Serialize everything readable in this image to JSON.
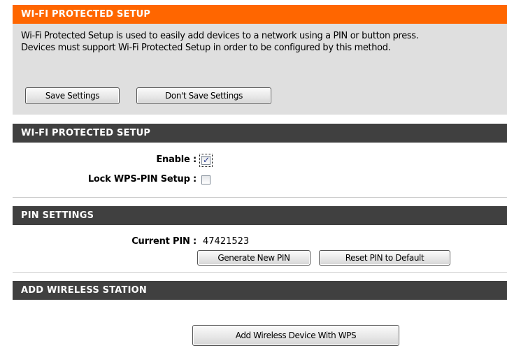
{
  "intro": {
    "header": "WI-FI PROTECTED SETUP",
    "line1": "Wi-Fi Protected Setup is used to easily add devices to a network using a PIN or button press.",
    "line2": "Devices must support Wi-Fi Protected Setup in order to be configured by this method.",
    "save_label": "Save Settings",
    "dont_save_label": "Don't Save Settings"
  },
  "wps": {
    "header": "WI-FI PROTECTED SETUP",
    "enable_label": "Enable :",
    "enable_checked": true,
    "lock_label": "Lock WPS-PIN Setup :",
    "lock_checked": false
  },
  "pin": {
    "header": "PIN SETTINGS",
    "current_pin_label": "Current PIN :",
    "current_pin_value": "47421523",
    "generate_label": "Generate New PIN",
    "reset_label": "Reset PIN to Default"
  },
  "add_station": {
    "header": "ADD WIRELESS STATION",
    "add_button_label": "Add Wireless Device With WPS"
  },
  "colors": {
    "orange_header": "#ff6600",
    "dark_header": "#404040",
    "intro_background": "#dfdfdf"
  }
}
